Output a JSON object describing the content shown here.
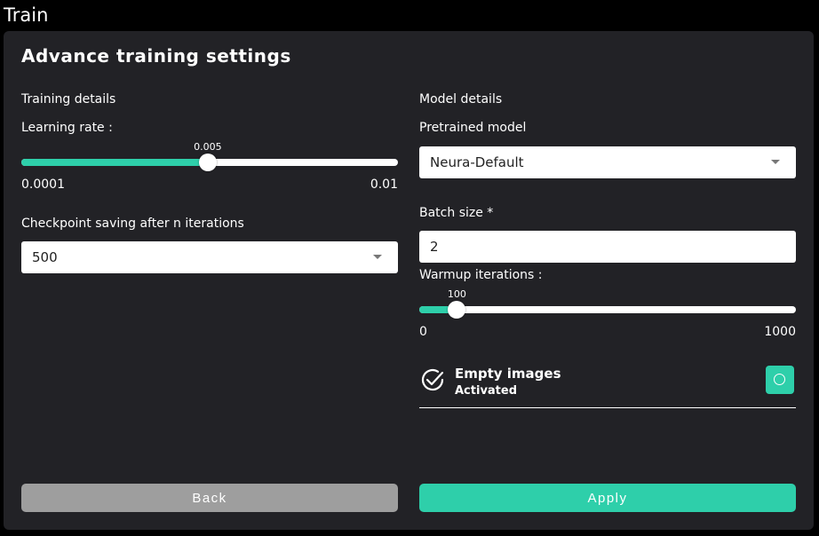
{
  "header": {
    "title": "Train"
  },
  "panel": {
    "title": "Advance training settings"
  },
  "training": {
    "section_label": "Training details",
    "learning_rate": {
      "label": "Learning rate :",
      "value": "0.005",
      "min_label": "0.0001",
      "max_label": "0.01",
      "fill_fraction": 0.495
    },
    "checkpoint": {
      "label": "Checkpoint saving after n iterations",
      "selected": "500"
    }
  },
  "model": {
    "section_label": "Model details",
    "pretrained": {
      "label": "Pretrained model",
      "selected": "Neura-Default"
    },
    "batch_size": {
      "label": "Batch size *",
      "value": "2"
    },
    "warmup": {
      "label": "Warmup iterations :",
      "value": "100",
      "min_label": "0",
      "max_label": "1000",
      "fill_fraction": 0.1
    },
    "empty_images": {
      "title": "Empty images",
      "status": "Activated"
    }
  },
  "actions": {
    "back_label": "Back",
    "apply_label": "Apply"
  },
  "colors": {
    "accent": "#2ecfaa",
    "panel_bg": "#222226",
    "back_btn": "#9e9e9e"
  },
  "icons": {
    "empty_images": "check-circle-icon",
    "toggle": "circle-toggle-icon",
    "select_caret": "caret-down-icon"
  }
}
